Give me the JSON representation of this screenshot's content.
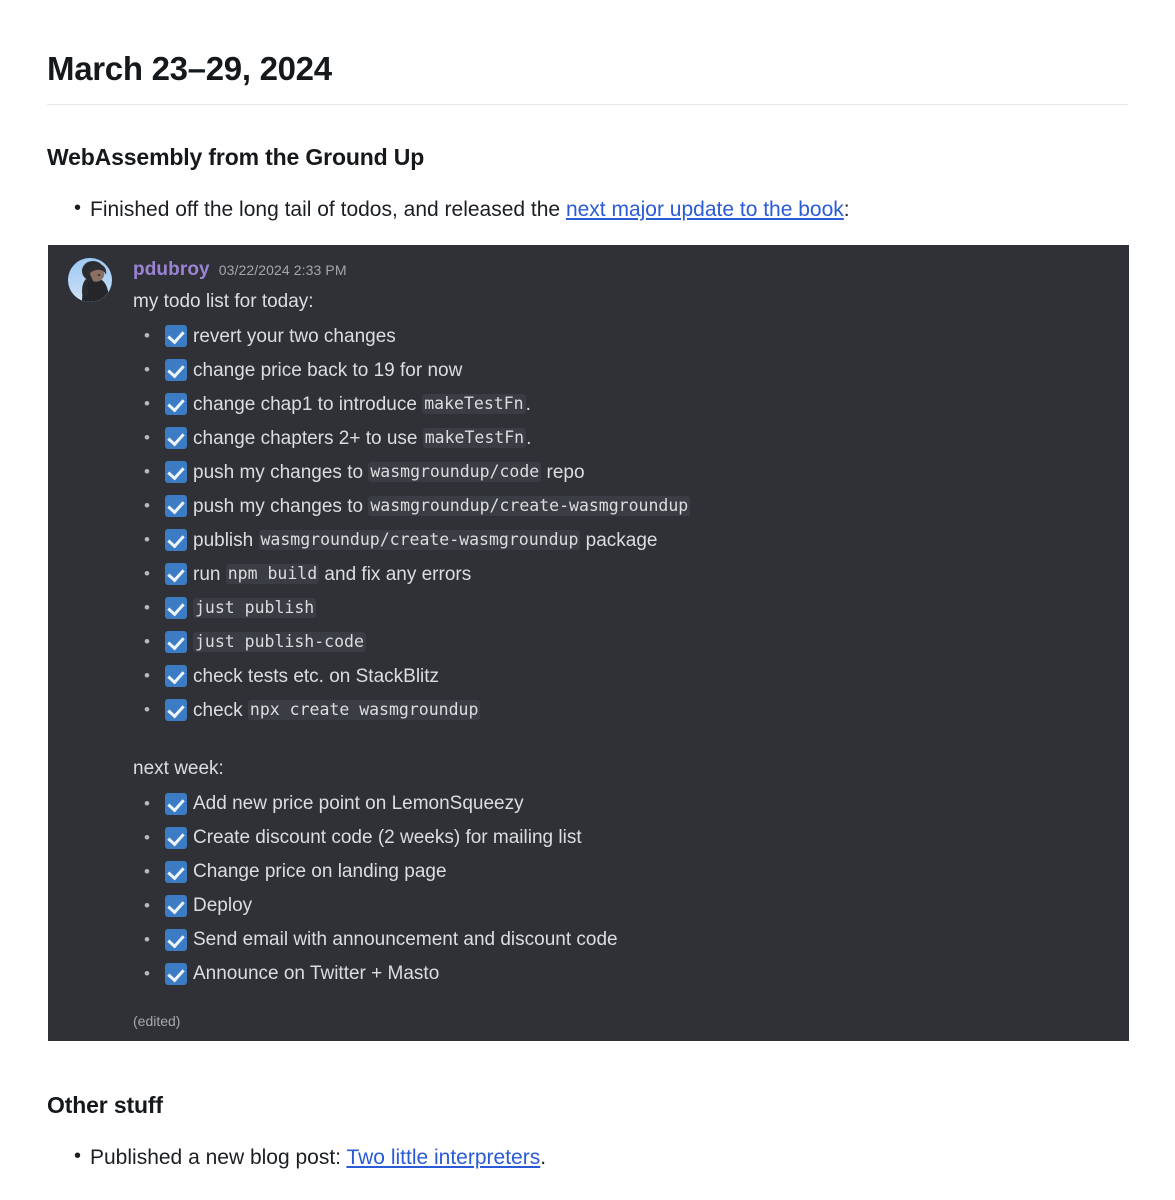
{
  "page": {
    "title": "March 23–29, 2024"
  },
  "sections": [
    {
      "heading": "WebAssembly from the Ground Up",
      "bullet_prefix": "Finished off the long tail of todos, and released the ",
      "bullet_link": "next major update to the book",
      "bullet_suffix": ":"
    },
    {
      "heading": "Other stuff",
      "bullet_prefix": "Published a new blog post: ",
      "bullet_link": "Two little interpreters",
      "bullet_suffix": "."
    }
  ],
  "discord": {
    "username": "pdubroy",
    "timestamp": "03/22/2024 2:33 PM",
    "intro_line": "my todo list for today:",
    "next_week_label": "next week:",
    "edited_label": "(edited)",
    "checkbox_icon": "white-check-mark-emoji",
    "colors": {
      "panel_bg": "#2f3136",
      "username": "#9b84d4",
      "text": "#dcddde",
      "code_bg": "#3a3d43",
      "checkbox": "#3b7cc4",
      "link": "#2a5bd7"
    },
    "today_items": [
      [
        {
          "t": "text",
          "v": "revert your two changes"
        }
      ],
      [
        {
          "t": "text",
          "v": "change price back to 19 for now"
        }
      ],
      [
        {
          "t": "text",
          "v": "change chap1 to introduce "
        },
        {
          "t": "code",
          "v": "makeTestFn"
        },
        {
          "t": "text",
          "v": "."
        }
      ],
      [
        {
          "t": "text",
          "v": "change chapters 2+ to use "
        },
        {
          "t": "code",
          "v": "makeTestFn"
        },
        {
          "t": "text",
          "v": "."
        }
      ],
      [
        {
          "t": "text",
          "v": "push my changes to "
        },
        {
          "t": "code",
          "v": "wasmgroundup/code"
        },
        {
          "t": "text",
          "v": " repo"
        }
      ],
      [
        {
          "t": "text",
          "v": "push my changes to "
        },
        {
          "t": "code",
          "v": "wasmgroundup/create-wasmgroundup"
        }
      ],
      [
        {
          "t": "text",
          "v": "publish "
        },
        {
          "t": "code",
          "v": "wasmgroundup/create-wasmgroundup"
        },
        {
          "t": "text",
          "v": " package"
        }
      ],
      [
        {
          "t": "text",
          "v": "run "
        },
        {
          "t": "code",
          "v": "npm build"
        },
        {
          "t": "text",
          "v": " and fix any errors"
        }
      ],
      [
        {
          "t": "code",
          "v": "just publish"
        }
      ],
      [
        {
          "t": "code",
          "v": "just publish-code"
        }
      ],
      [
        {
          "t": "text",
          "v": "check tests etc. on StackBlitz"
        }
      ],
      [
        {
          "t": "text",
          "v": "check "
        },
        {
          "t": "code",
          "v": "npx create wasmgroundup"
        }
      ]
    ],
    "next_week_items": [
      [
        {
          "t": "text",
          "v": "Add new price point on LemonSqueezy"
        }
      ],
      [
        {
          "t": "text",
          "v": "Create discount code (2 weeks) for mailing list"
        }
      ],
      [
        {
          "t": "text",
          "v": "Change price on landing page"
        }
      ],
      [
        {
          "t": "text",
          "v": "Deploy"
        }
      ],
      [
        {
          "t": "text",
          "v": "Send email with announcement and discount code"
        }
      ],
      [
        {
          "t": "text",
          "v": "Announce on Twitter + Masto"
        }
      ]
    ]
  }
}
